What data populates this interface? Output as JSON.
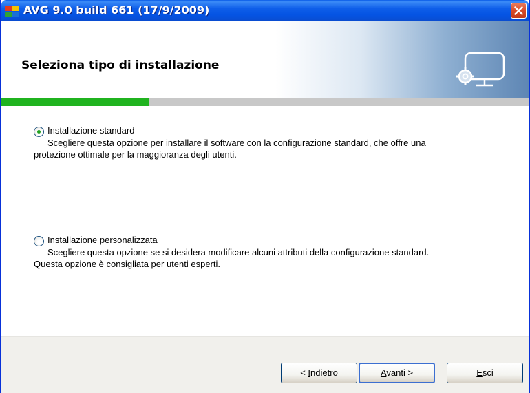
{
  "window": {
    "title": "AVG 9.0 build 661 (17/9/2009)"
  },
  "header": {
    "title": "Seleziona tipo di installazione",
    "icon": "computer-gear-icon"
  },
  "progress": {
    "fraction": 0.28,
    "color": "#20b31f"
  },
  "options": [
    {
      "label": "Installazione standard",
      "description_line1": "Scegliere questa opzione per installare il software con la configurazione standard, che offre una",
      "description_line2": "protezione ottimale per la maggioranza degli utenti.",
      "selected": true
    },
    {
      "label": "Installazione personalizzata",
      "description_line1": "Scegliere questa opzione se si desidera modificare alcuni attributi della configurazione standard.",
      "description_line2": "Questa opzione è consigliata per utenti esperti.",
      "selected": false
    }
  ],
  "buttons": {
    "back": {
      "prefix": "< ",
      "mnemonic": "I",
      "rest": "ndietro"
    },
    "next": {
      "mnemonic": "A",
      "rest": "vanti",
      "suffix": " >"
    },
    "exit": {
      "mnemonic": "E",
      "rest": "sci"
    }
  }
}
